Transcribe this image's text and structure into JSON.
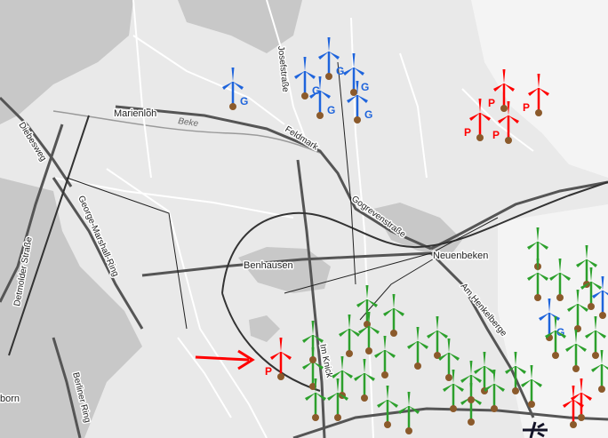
{
  "map": {
    "colors": {
      "background": "#e9e9e9",
      "settlement": "#c8c8c8",
      "forest": "#f4f4f4",
      "road": "#ffffff",
      "major_road": "#555555",
      "railway": "#333333",
      "planned": "#ff0000",
      "approved": "#1e64dc",
      "existing": "#2ca02c",
      "arrow": "#ff0000"
    },
    "places": [
      {
        "id": "marienloh",
        "label": "Marienloh"
      },
      {
        "id": "benhausen",
        "label": "Benhausen"
      },
      {
        "id": "neuenbeken",
        "label": "Neuenbeken"
      },
      {
        "id": "paderborn",
        "label": "born"
      }
    ],
    "streets": [
      {
        "id": "diebesweg",
        "label": "Diebesweg"
      },
      {
        "id": "josefstrasse",
        "label": "Josefstraße"
      },
      {
        "id": "feldmark",
        "label": "Feldmark"
      },
      {
        "id": "gogrevenstrasse",
        "label": "Gogrevenstraße"
      },
      {
        "id": "george-marshall-ring",
        "label": "George-Marshall-Ring"
      },
      {
        "id": "detmolder-strasse",
        "label": "Detmolder Straße"
      },
      {
        "id": "am-henkelberge",
        "label": "Am Henkelberge"
      },
      {
        "id": "im-knick",
        "label": "Im Knick"
      },
      {
        "id": "berliner-ring",
        "label": "Berliner Ring"
      }
    ],
    "water": [
      {
        "id": "beke",
        "label": "Beke"
      }
    ],
    "marker_labels": {
      "planned": "P",
      "approved": "G"
    },
    "icons": {
      "turbine": "wind-turbine-icon",
      "arrow": "arrow-right-icon",
      "aircraft": "aircraft-icon"
    }
  }
}
